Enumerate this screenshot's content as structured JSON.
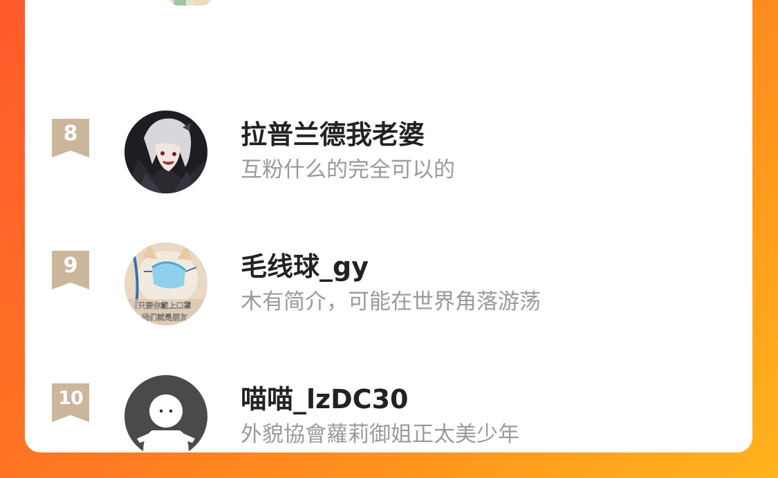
{
  "ranking": {
    "items": [
      {
        "rank": "8",
        "name": "拉普兰德我老婆",
        "bio": "互粉什么的完全可以的",
        "avatar_icon": "anime-character-avatar"
      },
      {
        "rank": "9",
        "name": "毛线球_gy",
        "bio": "木有简介，可能在世界角落游荡",
        "avatar_icon": "cat-mask-avatar",
        "avatar_caption_line1": "只要你戴上口罩",
        "avatar_caption_line2": "我们就是朋友"
      },
      {
        "rank": "10",
        "name": "喵喵_lzDC30",
        "bio": "外貌協會蘿莉御姐正太美少年",
        "avatar_icon": "default-user-avatar"
      }
    ]
  },
  "colors": {
    "rank_badge": "#cbb69c",
    "name_text": "#222222",
    "bio_text": "#9a9a9a",
    "background_start": "#ff5a2c",
    "background_end": "#ffb41e"
  }
}
